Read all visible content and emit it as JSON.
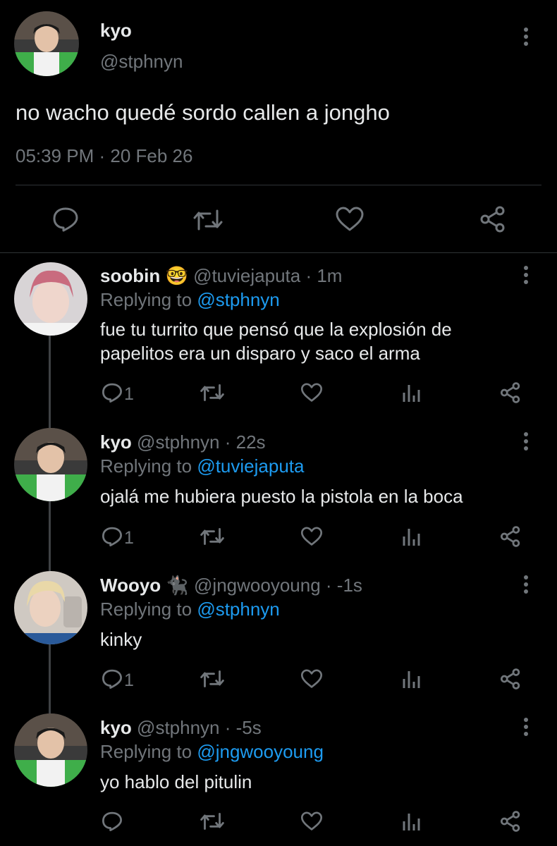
{
  "main_tweet": {
    "display_name": "kyo",
    "handle": "@stphnyn",
    "text": "no wacho quedé sordo callen a jongho",
    "timestamp": "05:39 PM · 20 Feb 26"
  },
  "replies": [
    {
      "display_name": "soobin",
      "emoji": "🤓",
      "handle": "@tuviejaputa",
      "time": "· 1m",
      "replying_label": "Replying to",
      "replying_to": "@stphnyn",
      "text_lines": [
        "fue tu turrito que pensó que la explosión de",
        "papelitos era un disparo y saco el arma"
      ],
      "reply_count": "1"
    },
    {
      "display_name": "kyo",
      "emoji": "",
      "handle": "@stphnyn",
      "time": "· 22s",
      "replying_label": "Replying to",
      "replying_to": "@tuviejaputa",
      "text_lines": [
        "ojalá me hubiera puesto la pistola en la boca"
      ],
      "reply_count": "1"
    },
    {
      "display_name": "Wooyo",
      "emoji": "🐈‍⬛",
      "handle": "@jngwooyoung",
      "time": "· -1s",
      "replying_label": "Replying to",
      "replying_to": "@stphnyn",
      "text_lines": [
        "kinky"
      ],
      "reply_count": "1"
    },
    {
      "display_name": "kyo",
      "emoji": "",
      "handle": "@stphnyn",
      "time": "· -5s",
      "replying_label": "Replying to",
      "replying_to": "@jngwooyoung",
      "text_lines": [
        "yo hablo del pitulin"
      ],
      "reply_count": ""
    }
  ],
  "colors": {
    "background": "#000000",
    "text": "#e7e9ea",
    "muted": "#71767b",
    "link": "#1d9bf0",
    "divider": "#2f3336"
  },
  "icons": [
    "reply-icon",
    "retweet-icon",
    "like-icon",
    "share-icon",
    "views-icon",
    "more-icon"
  ]
}
